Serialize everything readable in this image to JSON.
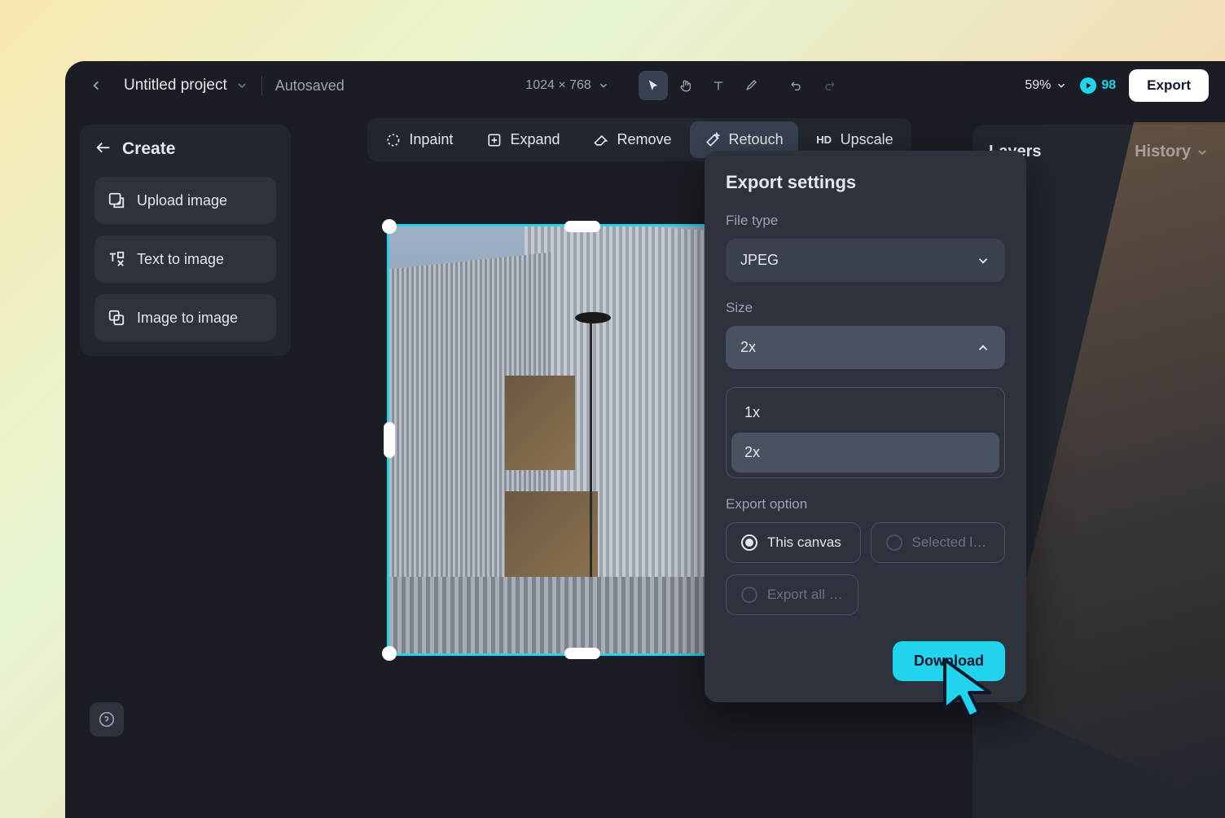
{
  "topbar": {
    "project_name": "Untitled project",
    "autosaved": "Autosaved",
    "canvas_size": "1024 × 768",
    "zoom": "59%",
    "credits": "98",
    "export": "Export"
  },
  "sidebar": {
    "title": "Create",
    "items": [
      {
        "label": "Upload image"
      },
      {
        "label": "Text to image"
      },
      {
        "label": "Image to image"
      }
    ]
  },
  "context_bar": [
    {
      "label": "Inpaint"
    },
    {
      "label": "Expand"
    },
    {
      "label": "Remove"
    },
    {
      "label": "Retouch",
      "active": true
    },
    {
      "label": "Upscale",
      "prefix": "HD"
    }
  ],
  "right_panel": {
    "tab_layers": "Layers",
    "tab_history": "History"
  },
  "export_popup": {
    "title": "Export settings",
    "file_type_label": "File type",
    "file_type_value": "JPEG",
    "size_label": "Size",
    "size_value": "2x",
    "size_options": [
      "1x",
      "2x"
    ],
    "export_option_label": "Export option",
    "options": {
      "this_canvas": "This canvas",
      "selected": "Selected l…",
      "export_all": "Export all …"
    },
    "download": "Download"
  },
  "colors": {
    "accent": "#22d3ee",
    "bg_dark": "#1a1d23",
    "panel": "#22262e"
  }
}
